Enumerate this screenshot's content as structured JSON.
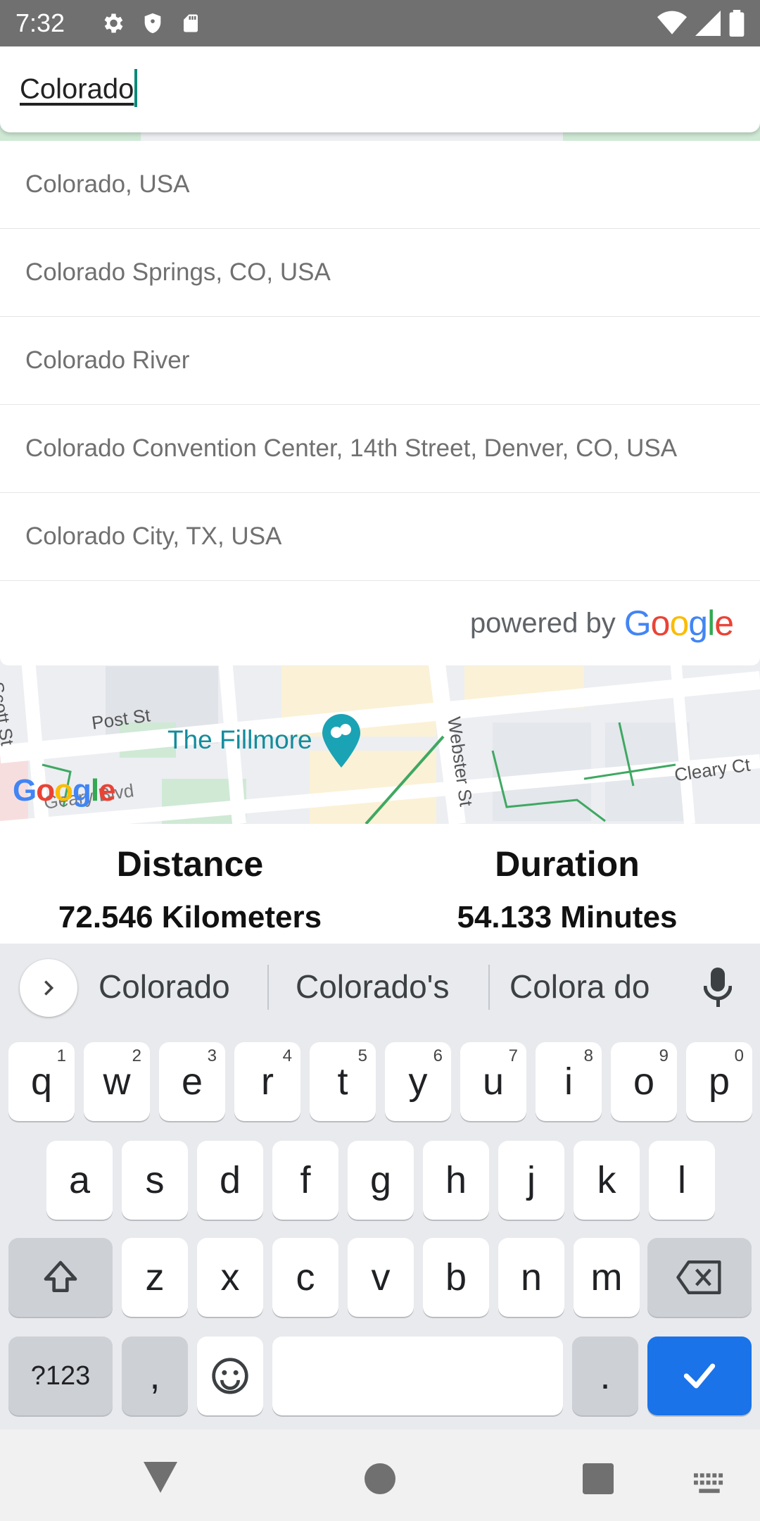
{
  "status_bar": {
    "time": "7:32"
  },
  "search": {
    "value": "Colorado"
  },
  "suggestions": [
    "Colorado, USA",
    "Colorado Springs, CO, USA",
    "Colorado River",
    "Colorado Convention Center, 14th Street, Denver, CO, USA",
    "Colorado City, TX, USA"
  ],
  "attribution": {
    "prefix": "powered by",
    "brand_g": "G",
    "brand_o1": "o",
    "brand_o2": "o",
    "brand_g2": "g",
    "brand_l": "l",
    "brand_e": "e"
  },
  "map": {
    "labels": {
      "scott": "Scott St",
      "post": "Post St",
      "webster": "Webster St",
      "cleary": "Cleary Ct",
      "geary": "Geary Blvd"
    },
    "poi": "The Fillmore",
    "logo": [
      "G",
      "o",
      "o",
      "g",
      "l",
      "e"
    ]
  },
  "info": {
    "distance_label": "Distance",
    "distance_value": "72.546 Kilometers",
    "duration_label": "Duration",
    "duration_value": "54.133 Minutes"
  },
  "keyboard": {
    "suggestions": [
      "Colorado",
      "Colorado's",
      "Colora do"
    ],
    "row1": [
      {
        "k": "q",
        "n": "1"
      },
      {
        "k": "w",
        "n": "2"
      },
      {
        "k": "e",
        "n": "3"
      },
      {
        "k": "r",
        "n": "4"
      },
      {
        "k": "t",
        "n": "5"
      },
      {
        "k": "y",
        "n": "6"
      },
      {
        "k": "u",
        "n": "7"
      },
      {
        "k": "i",
        "n": "8"
      },
      {
        "k": "o",
        "n": "9"
      },
      {
        "k": "p",
        "n": "0"
      }
    ],
    "row2": [
      "a",
      "s",
      "d",
      "f",
      "g",
      "h",
      "j",
      "k",
      "l"
    ],
    "row3": [
      "z",
      "x",
      "c",
      "v",
      "b",
      "n",
      "m"
    ],
    "symbols": "?123",
    "comma": ",",
    "period": "."
  },
  "colors": {
    "accent": "#1a73e8",
    "poi": "#138c9c",
    "status_bar": "#707070"
  }
}
